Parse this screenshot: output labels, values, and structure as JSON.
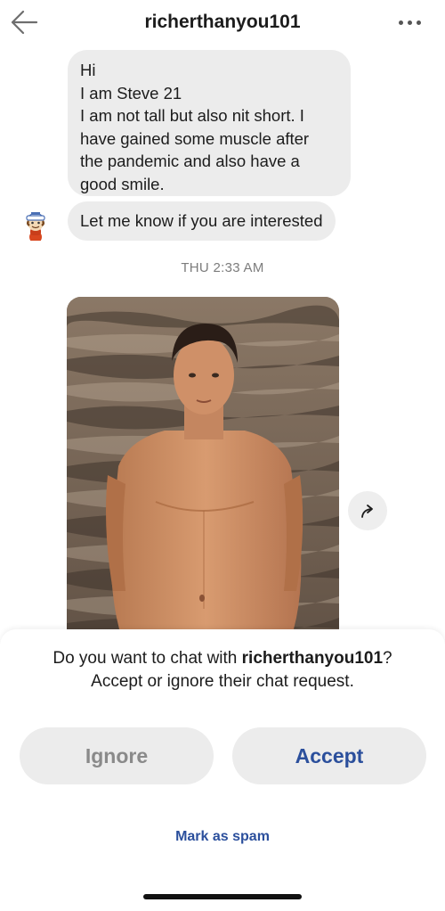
{
  "header": {
    "title": "richerthanyou101",
    "back_icon": "arrow-left-icon",
    "more_icon": "more-horizontal-icon"
  },
  "messages": {
    "first_bubble_lines": [
      "Hi",
      "I am Steve 21",
      "I am not tall but also nit short. I",
      "have gained some muscle after",
      "the pandemic and also have a",
      "good smile."
    ],
    "second_bubble": "Let me know if you are interested",
    "timestamp": "THU 2:33 AM",
    "share_icon": "share-arrow-icon"
  },
  "request_sheet": {
    "prompt_prefix": "Do you want to chat with ",
    "prompt_username": "richerthanyou101",
    "prompt_suffix": "?",
    "prompt_line2": "Accept or ignore their chat request.",
    "ignore_label": "Ignore",
    "accept_label": "Accept",
    "spam_label": "Mark as spam"
  },
  "colors": {
    "accent": "#2b4f9c",
    "bubble": "#ececec",
    "muted_text": "#7c7c7c"
  }
}
